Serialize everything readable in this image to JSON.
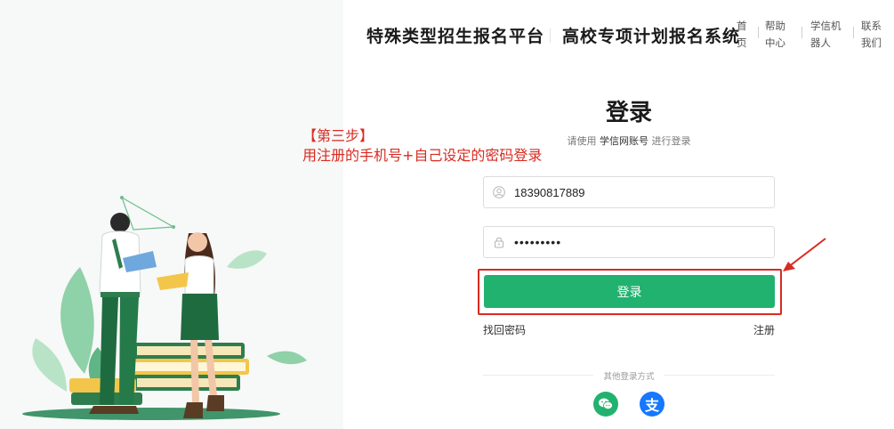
{
  "header": {
    "brand_title_1": "特殊类型招生报名平台",
    "brand_title_2": "高校专项计划报名系统",
    "nav": [
      {
        "label": "首页"
      },
      {
        "label": "帮助中心"
      },
      {
        "label": "学信机器人"
      },
      {
        "label": "联系我们"
      }
    ]
  },
  "annotation": {
    "line1": "【第三步】",
    "line2": "用注册的手机号+自己设定的密码登录"
  },
  "login": {
    "title": "登录",
    "subtitle_prefix": "请使用",
    "subtitle_account": "学信网账号",
    "subtitle_suffix": "进行登录",
    "phone_value": "18390817889",
    "password_value": "•••••••••",
    "button_label": "登录",
    "forgot_label": "找回密码",
    "register_label": "注册",
    "other_methods_label": "其他登录方式"
  },
  "icons": {
    "user": "user-icon",
    "lock": "lock-icon",
    "wechat": "wechat-icon",
    "alipay": "alipay-icon",
    "alipay_glyph": "支"
  },
  "colors": {
    "accent_green": "#22b26f",
    "annotation_red": "#d92b21",
    "alipay_blue": "#1677ff"
  }
}
